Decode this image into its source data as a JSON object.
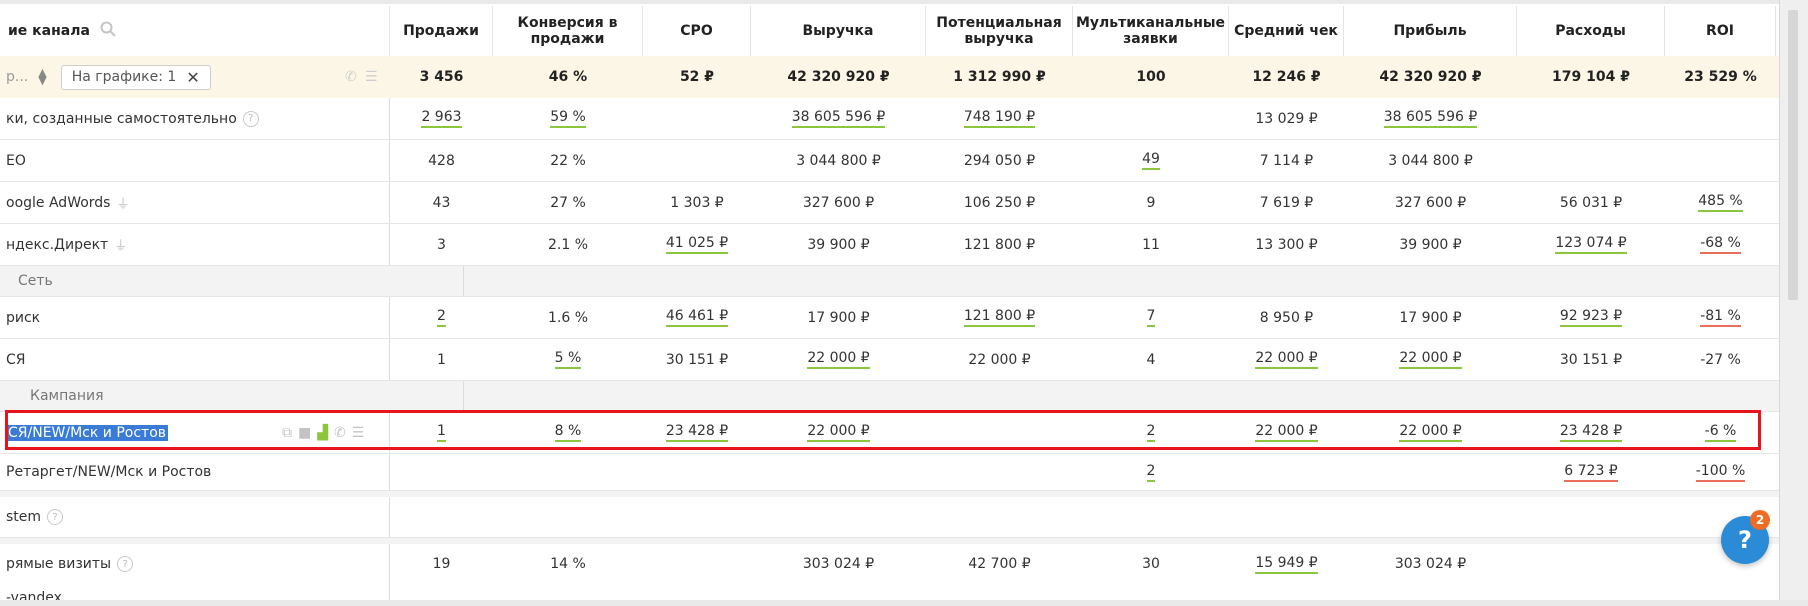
{
  "header": {
    "name_col": "ие канала",
    "cols": [
      "Продажи",
      "Конверсия в продажи",
      "CPO",
      "Выручка",
      "Потенциальная выручка",
      "Мультиканальные заявки",
      "Средний чек",
      "Прибыль",
      "Расходы",
      "ROI"
    ]
  },
  "total": {
    "left_text": "р...",
    "chip_label": "На графике: 1",
    "values": [
      "3 456",
      "46 %",
      "52 ₽",
      "42 320 920 ₽",
      "1 312 990 ₽",
      "100",
      "12 246 ₽",
      "42 320 920 ₽",
      "179 104 ₽",
      "23 529 %"
    ]
  },
  "groups": {
    "network": "Сеть",
    "campaign": "Кампания"
  },
  "rows": [
    {
      "name": "ки, созданные самостоятельно",
      "values": [
        "2 963",
        "59 %",
        "",
        "38 605 596 ₽",
        "748 190 ₽",
        "",
        "13 029 ₽",
        "38 605 596 ₽",
        "",
        ""
      ]
    },
    {
      "name": "EO",
      "values": [
        "428",
        "22 %",
        "",
        "3 044 800 ₽",
        "294 050 ₽",
        "49",
        "7 114 ₽",
        "3 044 800 ₽",
        "",
        ""
      ]
    },
    {
      "name": "oogle AdWords",
      "values": [
        "43",
        "27 %",
        "1 303 ₽",
        "327 600 ₽",
        "106 250 ₽",
        "9",
        "7 619 ₽",
        "327 600 ₽",
        "56 031 ₽",
        "485 %"
      ]
    },
    {
      "name": "ндекс.Директ",
      "values": [
        "3",
        "2.1 %",
        "41 025 ₽",
        "39 900 ₽",
        "121 800 ₽",
        "11",
        "13 300 ₽",
        "39 900 ₽",
        "123 074 ₽",
        "-68 %"
      ]
    },
    {
      "name": "риск",
      "values": [
        "2",
        "1.6 %",
        "46 461 ₽",
        "17 900 ₽",
        "121 800 ₽",
        "7",
        "8 950 ₽",
        "17 900 ₽",
        "92 923 ₽",
        "-81 %"
      ]
    },
    {
      "name": "СЯ",
      "values": [
        "1",
        "5 %",
        "30 151 ₽",
        "22 000 ₽",
        "22 000 ₽",
        "4",
        "22 000 ₽",
        "22 000 ₽",
        "30 151 ₽",
        "-27 %"
      ]
    },
    {
      "name": "СЯ/NEW/Мск и Ростов",
      "values": [
        "1",
        "8 %",
        "23 428 ₽",
        "22 000 ₽",
        "",
        "2",
        "22 000 ₽",
        "22 000 ₽",
        "23 428 ₽",
        "-6 %"
      ]
    },
    {
      "name": "Ретаргет/NEW/Мск и Ростов",
      "values": [
        "",
        "",
        "",
        "",
        "",
        "2",
        "",
        "",
        "6 723 ₽",
        "-100 %"
      ]
    },
    {
      "name": "stem",
      "values": [
        "",
        "",
        "",
        "",
        "",
        "",
        "",
        "",
        "",
        ""
      ]
    },
    {
      "name": "рямые визиты",
      "values": [
        "19",
        "14 %",
        "",
        "303 024 ₽",
        "42 700 ₽",
        "30",
        "15 949 ₽",
        "303 024 ₽",
        "",
        ""
      ]
    },
    {
      "name": "-vandex",
      "values": [
        "",
        "",
        "",
        "",
        "",
        "",
        "",
        "",
        "",
        ""
      ]
    }
  ],
  "help": {
    "label": "?",
    "badge": "2"
  },
  "colors": {
    "underline_green": "#8cc63f",
    "underline_red": "#e8705a",
    "total_bg": "#fbf6e6",
    "highlight": "#e8141d",
    "help_bg": "#2b8bd6"
  }
}
